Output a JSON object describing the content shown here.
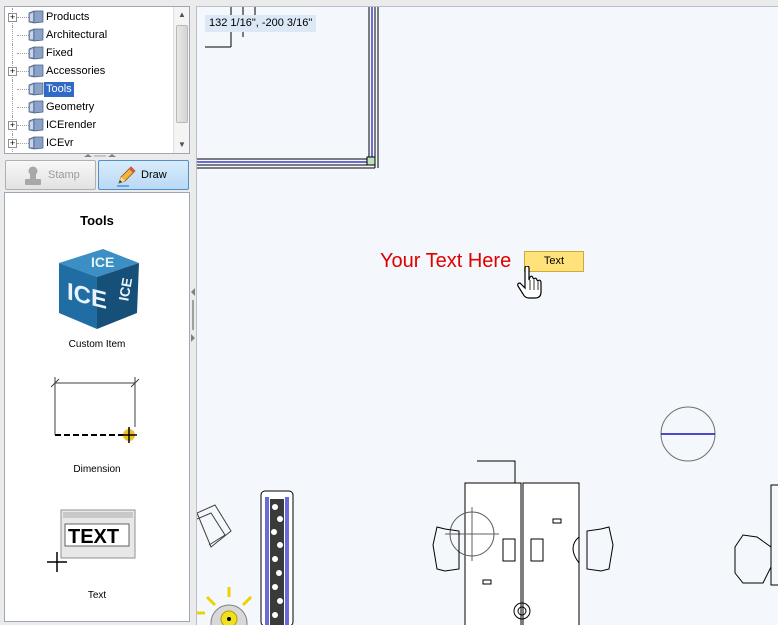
{
  "tree": {
    "items": [
      {
        "label": "Products",
        "expandable": true,
        "selected": false
      },
      {
        "label": "Architectural",
        "expandable": false,
        "selected": false
      },
      {
        "label": "Fixed",
        "expandable": false,
        "selected": false
      },
      {
        "label": "Accessories",
        "expandable": true,
        "selected": false
      },
      {
        "label": "Tools",
        "expandable": false,
        "selected": true
      },
      {
        "label": "Geometry",
        "expandable": false,
        "selected": false
      },
      {
        "label": "ICErender",
        "expandable": true,
        "selected": false
      },
      {
        "label": "ICEvr",
        "expandable": true,
        "selected": false
      }
    ]
  },
  "mode_tabs": {
    "stamp_label": "Stamp",
    "draw_label": "Draw",
    "active": "Draw"
  },
  "tools_panel": {
    "title": "Tools",
    "items": [
      {
        "caption": "Custom Item",
        "icon": "ice-cube-icon"
      },
      {
        "caption": "Dimension",
        "icon": "dimension-icon"
      },
      {
        "caption": "Text",
        "icon": "text-tool-icon"
      }
    ]
  },
  "canvas": {
    "coordinates": "132 1/16\", -200 3/16\"",
    "placed_text": "Your Text Here",
    "tooltip": "Text"
  },
  "colors": {
    "selection": "#3169c6",
    "placed_text": "#e00000",
    "tooltip_bg": "#ffe27a",
    "wall_blue": "#6a6ad8",
    "canvas_bg": "#f4f7fb"
  }
}
